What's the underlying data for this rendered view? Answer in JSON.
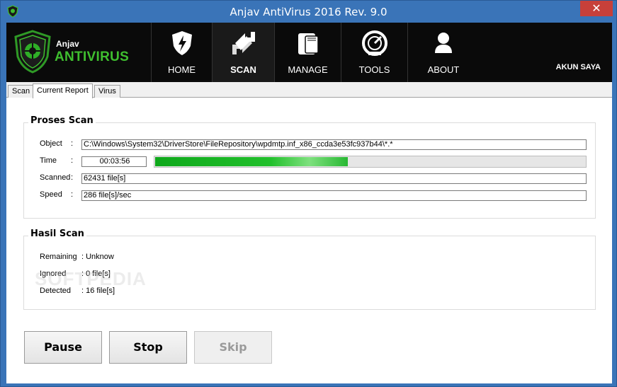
{
  "window": {
    "title": "Anjav AntiVirus 2016 Rev. 9.0",
    "close_glyph": "✕"
  },
  "logo": {
    "small": "Anjav",
    "big": "ANTIVIRUS"
  },
  "nav": {
    "items": [
      {
        "label": "HOME",
        "icon": "shield-icon"
      },
      {
        "label": "SCAN",
        "icon": "scan-arrows-icon"
      },
      {
        "label": "MANAGE",
        "icon": "wallet-icon"
      },
      {
        "label": "TOOLS",
        "icon": "gauge-icon"
      },
      {
        "label": "ABOUT",
        "icon": "user-icon"
      }
    ],
    "account": "AKUN SAYA"
  },
  "tabs": [
    {
      "label": "Scan"
    },
    {
      "label": "Current Report"
    },
    {
      "label": "Virus"
    }
  ],
  "proses": {
    "title": "Proses Scan",
    "object_label": "Object",
    "object_value": "C:\\Windows\\System32\\DriverStore\\FileRepository\\wpdmtp.inf_x86_ccda3e53fc937b44\\*.*",
    "time_label": "Time",
    "time_value": "00:03:56",
    "progress": 0.45,
    "scanned_label": "Scanned",
    "scanned_value": "62431 file[s]",
    "speed_label": "Speed",
    "speed_value": "286 file[s]/sec",
    "colon": ":"
  },
  "hasil": {
    "title": "Hasil Scan",
    "remaining_label": "Remaining",
    "remaining_value": ": Unknow",
    "ignored_label": "Ignored",
    "ignored_value": ": 0 file[s]",
    "detected_label": "Detected",
    "detected_value": ": 16 file[s]"
  },
  "watermark": "SOFTPEDIA",
  "buttons": {
    "pause": "Pause",
    "stop": "Stop",
    "skip": "Skip"
  },
  "colors": {
    "accent_green": "#3fbf2f",
    "titlebar": "#3a74b8",
    "close": "#c7403a"
  }
}
